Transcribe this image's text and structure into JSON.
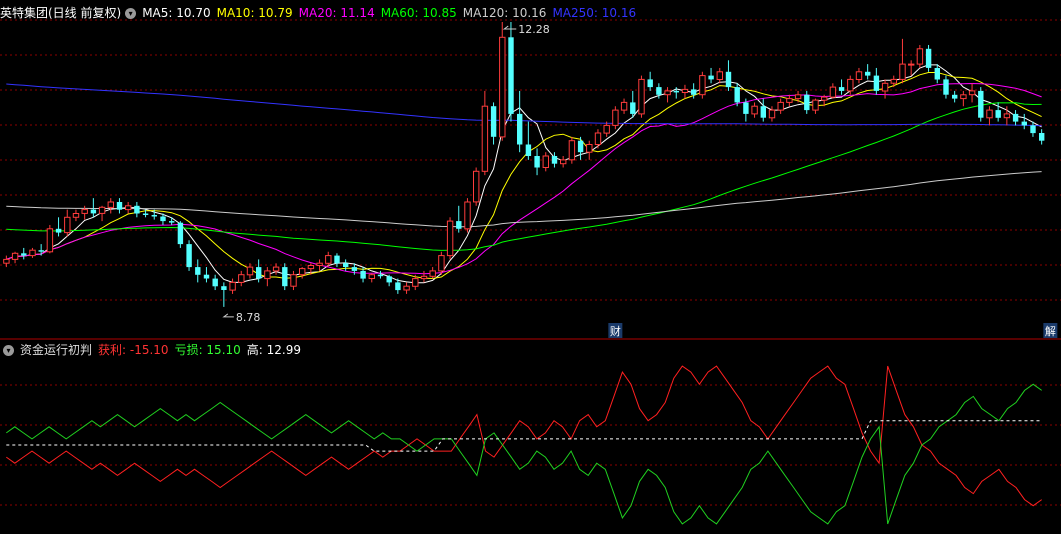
{
  "header": {
    "stock_title": "英特集团(日线 前复权)",
    "ma_labels": [
      {
        "text": "MA5: 10.70",
        "color": "#ffffff"
      },
      {
        "text": "MA10: 10.79",
        "color": "#ffff00"
      },
      {
        "text": "MA20: 11.14",
        "color": "#ff00ff"
      },
      {
        "text": "MA60: 10.85",
        "color": "#00ff00"
      },
      {
        "text": "MA120: 10.16",
        "color": "#cccccc"
      },
      {
        "text": "MA250: 10.16",
        "color": "#3333ff"
      }
    ]
  },
  "indicator": {
    "title": "资金运行初判",
    "labels": [
      {
        "text": "获利: -15.10",
        "color": "#ff3333"
      },
      {
        "text": "亏损: 15.10",
        "color": "#33ff33"
      },
      {
        "text": "高: 12.99",
        "color": "#ffffff"
      }
    ]
  },
  "colors": {
    "up": "#ff3c3c",
    "down": "#54ffff",
    "grid": "#8b0000",
    "border": "#b00000",
    "profit": "#ff2020",
    "loss": "#20d020",
    "high_line": "#ffffff"
  },
  "chart_data": [
    {
      "type": "candlestick",
      "ylim": [
        8.4,
        12.5
      ],
      "high_annotation": "12.28",
      "low_annotation": "8.78",
      "event_markers": [
        {
          "text": "财",
          "index": 70
        },
        {
          "text": "解",
          "index": 120
        }
      ],
      "ohlc": [
        [
          9.35,
          9.45,
          9.3,
          9.4
        ],
        [
          9.4,
          9.5,
          9.35,
          9.48
        ],
        [
          9.48,
          9.55,
          9.4,
          9.45
        ],
        [
          9.45,
          9.55,
          9.42,
          9.52
        ],
        [
          9.52,
          9.6,
          9.45,
          9.5
        ],
        [
          9.5,
          9.85,
          9.48,
          9.8
        ],
        [
          9.8,
          9.95,
          9.7,
          9.75
        ],
        [
          9.75,
          10.05,
          9.7,
          9.95
        ],
        [
          9.95,
          10.05,
          9.9,
          10.0
        ],
        [
          10.0,
          10.1,
          9.92,
          10.05
        ],
        [
          10.05,
          10.2,
          9.95,
          10.0
        ],
        [
          10.0,
          10.1,
          9.9,
          10.08
        ],
        [
          10.08,
          10.2,
          10.0,
          10.15
        ],
        [
          10.15,
          10.2,
          10.0,
          10.05
        ],
        [
          10.05,
          10.15,
          10.0,
          10.1
        ],
        [
          10.1,
          10.15,
          9.95,
          10.0
        ],
        [
          10.0,
          10.05,
          9.95,
          9.98
        ],
        [
          9.98,
          10.05,
          9.92,
          9.96
        ],
        [
          9.96,
          10.0,
          9.85,
          9.9
        ],
        [
          9.9,
          9.95,
          9.85,
          9.88
        ],
        [
          9.88,
          9.9,
          9.55,
          9.6
        ],
        [
          9.6,
          9.65,
          9.25,
          9.3
        ],
        [
          9.3,
          9.4,
          9.1,
          9.2
        ],
        [
          9.2,
          9.3,
          9.1,
          9.15
        ],
        [
          9.15,
          9.2,
          9.0,
          9.05
        ],
        [
          9.05,
          9.1,
          8.78,
          9.0
        ],
        [
          9.0,
          9.15,
          8.95,
          9.1
        ],
        [
          9.1,
          9.25,
          9.05,
          9.2
        ],
        [
          9.2,
          9.35,
          9.15,
          9.3
        ],
        [
          9.3,
          9.4,
          9.1,
          9.15
        ],
        [
          9.15,
          9.3,
          9.05,
          9.25
        ],
        [
          9.25,
          9.35,
          9.2,
          9.3
        ],
        [
          9.3,
          9.35,
          9.0,
          9.05
        ],
        [
          9.05,
          9.25,
          9.0,
          9.2
        ],
        [
          9.2,
          9.3,
          9.15,
          9.28
        ],
        [
          9.28,
          9.35,
          9.2,
          9.32
        ],
        [
          9.32,
          9.4,
          9.25,
          9.35
        ],
        [
          9.35,
          9.5,
          9.3,
          9.45
        ],
        [
          9.45,
          9.48,
          9.3,
          9.35
        ],
        [
          9.35,
          9.4,
          9.25,
          9.3
        ],
        [
          9.3,
          9.35,
          9.2,
          9.25
        ],
        [
          9.25,
          9.3,
          9.1,
          9.15
        ],
        [
          9.15,
          9.22,
          9.1,
          9.2
        ],
        [
          9.2,
          9.25,
          9.15,
          9.18
        ],
        [
          9.18,
          9.2,
          9.05,
          9.1
        ],
        [
          9.1,
          9.15,
          8.95,
          9.0
        ],
        [
          9.0,
          9.1,
          8.95,
          9.05
        ],
        [
          9.05,
          9.2,
          9.0,
          9.15
        ],
        [
          9.15,
          9.25,
          9.1,
          9.18
        ],
        [
          9.18,
          9.3,
          9.15,
          9.25
        ],
        [
          9.25,
          9.5,
          9.2,
          9.45
        ],
        [
          9.45,
          9.95,
          9.4,
          9.9
        ],
        [
          9.9,
          10.1,
          9.75,
          9.8
        ],
        [
          9.8,
          10.2,
          9.75,
          10.15
        ],
        [
          10.15,
          10.6,
          10.1,
          10.55
        ],
        [
          10.55,
          11.6,
          10.5,
          11.4
        ],
        [
          11.4,
          11.45,
          10.9,
          11.0
        ],
        [
          11.0,
          12.5,
          10.95,
          12.3
        ],
        [
          12.3,
          12.5,
          11.2,
          11.3
        ],
        [
          11.3,
          11.6,
          10.8,
          10.9
        ],
        [
          10.9,
          11.2,
          10.7,
          10.75
        ],
        [
          10.75,
          10.85,
          10.5,
          10.6
        ],
        [
          10.6,
          10.8,
          10.55,
          10.75
        ],
        [
          10.75,
          10.8,
          10.6,
          10.65
        ],
        [
          10.65,
          10.75,
          10.6,
          10.7
        ],
        [
          10.7,
          11.0,
          10.65,
          10.95
        ],
        [
          10.95,
          11.0,
          10.7,
          10.8
        ],
        [
          10.8,
          10.95,
          10.7,
          10.9
        ],
        [
          10.9,
          11.1,
          10.85,
          11.05
        ],
        [
          11.05,
          11.2,
          11.0,
          11.15
        ],
        [
          11.15,
          11.4,
          11.1,
          11.35
        ],
        [
          11.35,
          11.5,
          11.3,
          11.45
        ],
        [
          11.45,
          11.6,
          11.25,
          11.3
        ],
        [
          11.3,
          11.8,
          11.25,
          11.75
        ],
        [
          11.75,
          11.85,
          11.6,
          11.65
        ],
        [
          11.65,
          11.7,
          11.5,
          11.55
        ],
        [
          11.55,
          11.65,
          11.45,
          11.6
        ],
        [
          11.6,
          11.65,
          11.5,
          11.58
        ],
        [
          11.58,
          11.68,
          11.5,
          11.62
        ],
        [
          11.62,
          11.7,
          11.5,
          11.55
        ],
        [
          11.55,
          11.85,
          11.5,
          11.8
        ],
        [
          11.8,
          11.9,
          11.7,
          11.75
        ],
        [
          11.75,
          11.9,
          11.7,
          11.85
        ],
        [
          11.85,
          12.0,
          11.6,
          11.65
        ],
        [
          11.65,
          11.7,
          11.4,
          11.45
        ],
        [
          11.45,
          11.5,
          11.2,
          11.3
        ],
        [
          11.3,
          11.45,
          11.25,
          11.4
        ],
        [
          11.4,
          11.5,
          11.2,
          11.25
        ],
        [
          11.25,
          11.4,
          11.2,
          11.35
        ],
        [
          11.35,
          11.5,
          11.3,
          11.45
        ],
        [
          11.45,
          11.55,
          11.4,
          11.5
        ],
        [
          11.5,
          11.6,
          11.45,
          11.55
        ],
        [
          11.55,
          11.6,
          11.3,
          11.35
        ],
        [
          11.35,
          11.5,
          11.3,
          11.48
        ],
        [
          11.48,
          11.55,
          11.4,
          11.52
        ],
        [
          11.52,
          11.7,
          11.5,
          11.65
        ],
        [
          11.65,
          11.75,
          11.55,
          11.6
        ],
        [
          11.6,
          11.8,
          11.55,
          11.75
        ],
        [
          11.75,
          11.9,
          11.7,
          11.85
        ],
        [
          11.85,
          11.95,
          11.75,
          11.8
        ],
        [
          11.8,
          11.9,
          11.55,
          11.6
        ],
        [
          11.6,
          11.75,
          11.5,
          11.7
        ],
        [
          11.7,
          11.8,
          11.65,
          11.75
        ],
        [
          11.75,
          12.28,
          11.7,
          11.95
        ],
        [
          11.95,
          12.0,
          11.8,
          11.95
        ],
        [
          11.95,
          12.2,
          11.9,
          12.15
        ],
        [
          12.15,
          12.2,
          11.85,
          11.9
        ],
        [
          11.9,
          11.95,
          11.7,
          11.75
        ],
        [
          11.75,
          11.8,
          11.5,
          11.55
        ],
        [
          11.55,
          11.6,
          11.45,
          11.5
        ],
        [
          11.5,
          11.6,
          11.4,
          11.55
        ],
        [
          11.55,
          11.7,
          11.45,
          11.6
        ],
        [
          11.6,
          11.65,
          11.2,
          11.25
        ],
        [
          11.25,
          11.4,
          11.15,
          11.35
        ],
        [
          11.35,
          11.45,
          11.2,
          11.25
        ],
        [
          11.25,
          11.4,
          11.15,
          11.3
        ],
        [
          11.3,
          11.35,
          11.15,
          11.2
        ],
        [
          11.2,
          11.3,
          11.1,
          11.15
        ],
        [
          11.15,
          11.2,
          11.0,
          11.05
        ],
        [
          11.05,
          11.1,
          10.9,
          10.95
        ]
      ]
    },
    {
      "type": "line",
      "series": [
        {
          "name": "获利",
          "color": "#ff2020",
          "values": [
            -2,
            -3,
            -2,
            -1,
            -2,
            -3,
            -2,
            -1,
            -2,
            -3,
            -4,
            -3,
            -4,
            -5,
            -4,
            -3,
            -4,
            -5,
            -6,
            -5,
            -4,
            -5,
            -4,
            -5,
            -6,
            -7,
            -6,
            -5,
            -4,
            -3,
            -2,
            -1,
            -2,
            -3,
            -4,
            -5,
            -4,
            -3,
            -2,
            -3,
            -4,
            -3,
            -2,
            -1,
            -2,
            -1,
            -1,
            0,
            1,
            0,
            -1,
            -1,
            -1,
            1,
            3,
            5,
            -1,
            -2,
            0,
            2,
            4,
            3,
            1,
            2,
            4,
            3,
            1,
            4,
            5,
            3,
            4,
            8,
            12,
            10,
            6,
            4,
            5,
            7,
            11,
            13,
            12,
            10,
            12,
            13,
            11,
            9,
            7,
            4,
            3,
            1,
            3,
            5,
            7,
            9,
            11,
            12,
            13,
            11,
            10,
            6,
            2,
            -1,
            -3,
            13,
            9,
            5,
            3,
            0,
            -1,
            -3,
            -4,
            -5,
            -7,
            -8,
            -6,
            -5,
            -4,
            -6,
            -7,
            -9,
            -10,
            -9
          ]
        },
        {
          "name": "亏损",
          "color": "#20d020",
          "values": [
            2,
            3,
            2,
            1,
            2,
            3,
            2,
            1,
            2,
            3,
            4,
            3,
            4,
            5,
            4,
            3,
            4,
            5,
            6,
            5,
            4,
            5,
            4,
            5,
            6,
            7,
            6,
            5,
            4,
            3,
            2,
            1,
            2,
            3,
            4,
            5,
            4,
            3,
            2,
            3,
            4,
            3,
            2,
            1,
            2,
            1,
            1,
            0,
            -1,
            0,
            1,
            1,
            1,
            -1,
            -3,
            -5,
            1,
            2,
            0,
            -2,
            -4,
            -3,
            -1,
            -2,
            -4,
            -3,
            -1,
            -4,
            -5,
            -3,
            -4,
            -8,
            -12,
            -10,
            -6,
            -4,
            -5,
            -7,
            -11,
            -13,
            -12,
            -10,
            -12,
            -13,
            -11,
            -9,
            -7,
            -4,
            -3,
            -1,
            -3,
            -5,
            -7,
            -9,
            -11,
            -12,
            -13,
            -11,
            -10,
            -6,
            -2,
            1,
            3,
            -13,
            -9,
            -5,
            -3,
            0,
            1,
            3,
            4,
            5,
            7,
            8,
            6,
            5,
            4,
            6,
            7,
            9,
            10,
            9
          ]
        },
        {
          "name": "高",
          "color": "#ffffff",
          "dashed": true,
          "values": [
            0,
            0,
            0,
            0,
            0,
            0,
            0,
            0,
            0,
            0,
            0,
            0,
            0,
            0,
            0,
            0,
            0,
            0,
            0,
            0,
            0,
            0,
            0,
            0,
            0,
            0,
            0,
            0,
            0,
            0,
            0,
            0,
            0,
            0,
            0,
            0,
            0,
            0,
            0,
            0,
            0,
            0,
            0,
            -1,
            -1,
            -1,
            -1,
            -1,
            -1,
            -1,
            -1,
            1,
            1,
            1,
            1,
            1,
            1,
            1,
            1,
            1,
            1,
            1,
            1,
            1,
            1,
            1,
            1,
            1,
            1,
            1,
            1,
            1,
            1,
            1,
            1,
            1,
            1,
            1,
            1,
            1,
            1,
            1,
            1,
            1,
            1,
            1,
            1,
            1,
            1,
            1,
            1,
            1,
            1,
            1,
            1,
            1,
            1,
            1,
            1,
            1,
            1,
            4,
            4,
            4,
            4,
            4,
            4,
            4,
            4,
            4,
            4,
            4,
            4,
            4,
            4,
            4,
            4,
            4,
            4,
            4,
            4,
            4
          ]
        }
      ],
      "ylim": [
        -14,
        14
      ]
    }
  ]
}
